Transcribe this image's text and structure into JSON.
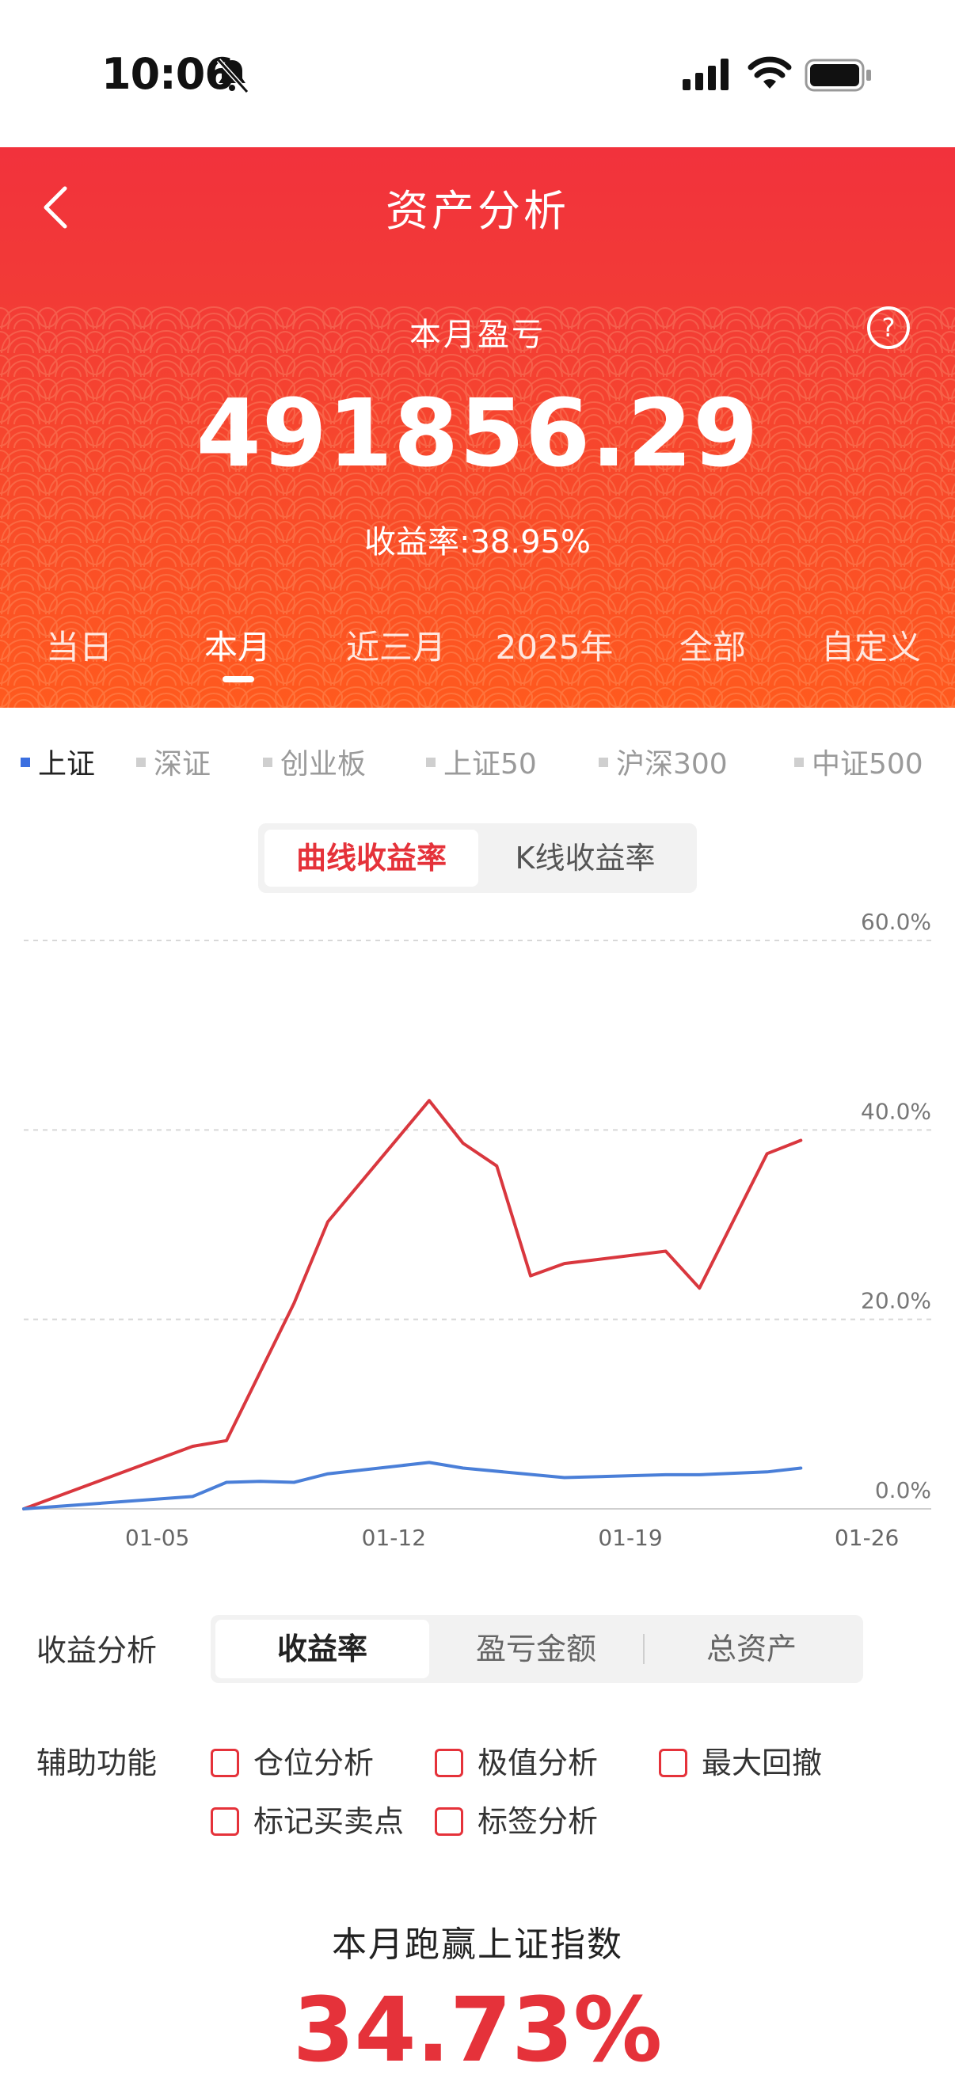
{
  "status_bar": {
    "time": "10:06"
  },
  "header": {
    "title": "资产分析",
    "pnl_label": "本月盈亏",
    "pnl_value": "491856.29",
    "return_rate": "收益率:38.95%"
  },
  "periods": [
    {
      "label": "当日"
    },
    {
      "label": "本月",
      "active": true
    },
    {
      "label": "近三月"
    },
    {
      "label": "2025年"
    },
    {
      "label": "全部"
    },
    {
      "label": "自定义"
    }
  ],
  "indices": [
    {
      "label": "上证",
      "active": true
    },
    {
      "label": "深证"
    },
    {
      "label": "创业板"
    },
    {
      "label": "上证50"
    },
    {
      "label": "沪深300"
    },
    {
      "label": "中证500"
    }
  ],
  "chart_mode": {
    "curve": "曲线收益率",
    "kline": "K线收益率"
  },
  "chart_data": {
    "type": "line",
    "x_tick_labels": [
      "01-05",
      "01-12",
      "01-19",
      "01-26"
    ],
    "y_tick_labels": [
      "60.0%",
      "40.0%",
      "20.0%",
      "0.0%"
    ],
    "ylim": [
      0,
      60
    ],
    "grid": true,
    "colors": {
      "portfolio": "#d9373e",
      "index": "#4a7fd8"
    },
    "series": [
      {
        "key": "portfolio",
        "points": [
          [
            0,
            0
          ],
          [
            5,
            6.6
          ],
          [
            6,
            7.2
          ],
          [
            8,
            21.7
          ],
          [
            9,
            30.3
          ],
          [
            12,
            43.1
          ],
          [
            13,
            38.6
          ],
          [
            14,
            36.2
          ],
          [
            15,
            24.6
          ],
          [
            16,
            25.9
          ],
          [
            19,
            27.2
          ],
          [
            20,
            23.3
          ],
          [
            22,
            37.5
          ],
          [
            23,
            38.9
          ]
        ]
      },
      {
        "key": "index",
        "points": [
          [
            0,
            0
          ],
          [
            5,
            1.3
          ],
          [
            6,
            2.8
          ],
          [
            7,
            2.9
          ],
          [
            8,
            2.8
          ],
          [
            9,
            3.7
          ],
          [
            12,
            4.9
          ],
          [
            13,
            4.3
          ],
          [
            16,
            3.3
          ],
          [
            19,
            3.6
          ],
          [
            20,
            3.6
          ],
          [
            22,
            3.9
          ],
          [
            23,
            4.3
          ]
        ]
      }
    ]
  },
  "analysis": {
    "label": "收益分析",
    "options": [
      "收益率",
      "盈亏金额",
      "总资产"
    ]
  },
  "auxiliary": {
    "label": "辅助功能",
    "options": [
      "仓位分析",
      "极值分析",
      "最大回撤",
      "标记买卖点",
      "标签分析"
    ]
  },
  "beat": {
    "title": "本月跑赢上证指数",
    "value": "34.73%"
  }
}
